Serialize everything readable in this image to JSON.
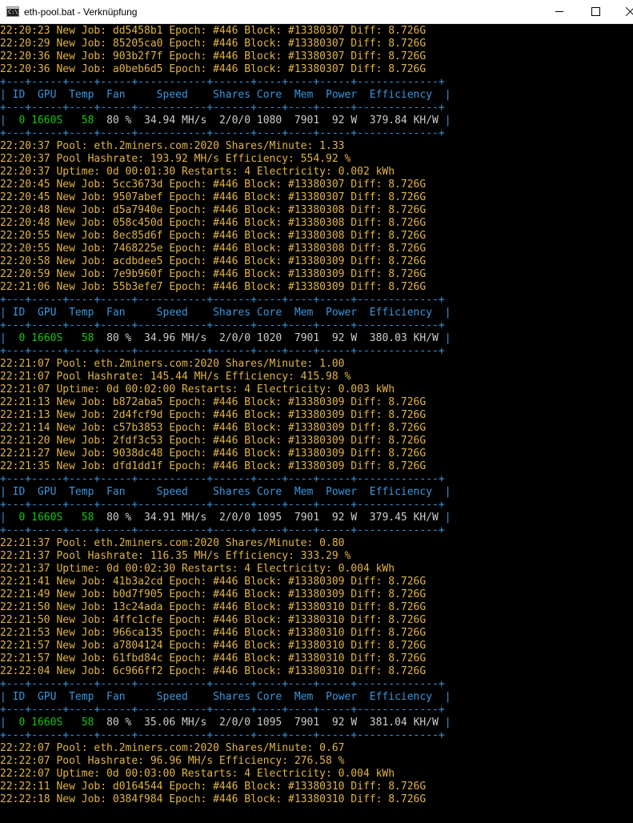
{
  "window": {
    "title": "eth-pool.bat - Verknüpfung",
    "icon": "console-icon",
    "controls": [
      "minimize",
      "maximize",
      "close"
    ]
  },
  "colors": {
    "job_text": "#e1b445",
    "table_border": "#3a96dd",
    "gpu_id": "#16c60c"
  },
  "console": {
    "lines": [
      {
        "kind": "job",
        "text": "22:20:23 New Job: dd5458b1 Epoch: #446 Block: #13380307 Diff: 8.726G"
      },
      {
        "kind": "job",
        "text": "22:20:29 New Job: 85205ca0 Epoch: #446 Block: #13380307 Diff: 8.726G"
      },
      {
        "kind": "job",
        "text": "22:20:36 New Job: 903b2f7f Epoch: #446 Block: #13380307 Diff: 8.726G"
      },
      {
        "kind": "job",
        "text": "22:20:36 New Job: a0beb6d5 Epoch: #446 Block: #13380307 Diff: 8.726G"
      },
      {
        "kind": "border",
        "text": "+---+-----+----+-----+-----------+------+----+----+-----+-------------+"
      },
      {
        "kind": "header",
        "text": "| ID  GPU  Temp  Fan     Speed    Shares Core  Mem  Power  Efficiency  |"
      },
      {
        "kind": "border",
        "text": "+---+-----+----+-----+-----------+------+----+----+-----+-------------+"
      },
      {
        "kind": "row",
        "id": " 0",
        "gpu": "1660S",
        "temp": "58",
        "rest": "  80 %  34.94 MH/s  2/0/0 1080  7901  92 W  379.84 KH/W "
      },
      {
        "kind": "border",
        "text": "+---+-----+----+-----+-----------+------+----+----+-----+-------------+"
      },
      {
        "kind": "job",
        "text": "22:20:37 Pool: eth.2miners.com:2020 Shares/Minute: 1.33"
      },
      {
        "kind": "job",
        "text": "22:20:37 Pool Hashrate: 193.92 MH/s Efficiency: 554.92 %"
      },
      {
        "kind": "job",
        "text": "22:20:37 Uptime: 0d 00:01:30 Restarts: 4 Electricity: 0.002 kWh"
      },
      {
        "kind": "job",
        "text": "22:20:45 New Job: 5cc3673d Epoch: #446 Block: #13380307 Diff: 8.726G"
      },
      {
        "kind": "job",
        "text": "22:20:45 New Job: 9507abef Epoch: #446 Block: #13380307 Diff: 8.726G"
      },
      {
        "kind": "job",
        "text": "22:20:48 New Job: d5a7940e Epoch: #446 Block: #13380308 Diff: 8.726G"
      },
      {
        "kind": "job",
        "text": "22:20:48 New Job: 058c450d Epoch: #446 Block: #13380308 Diff: 8.726G"
      },
      {
        "kind": "job",
        "text": "22:20:55 New Job: 8ec85d6f Epoch: #446 Block: #13380308 Diff: 8.726G"
      },
      {
        "kind": "job",
        "text": "22:20:55 New Job: 7468225e Epoch: #446 Block: #13380308 Diff: 8.726G"
      },
      {
        "kind": "job",
        "text": "22:20:58 New Job: acdbdee5 Epoch: #446 Block: #13380309 Diff: 8.726G"
      },
      {
        "kind": "job",
        "text": "22:20:59 New Job: 7e9b960f Epoch: #446 Block: #13380309 Diff: 8.726G"
      },
      {
        "kind": "job",
        "text": "22:21:06 New Job: 55b3efe7 Epoch: #446 Block: #13380309 Diff: 8.726G"
      },
      {
        "kind": "border",
        "text": "+---+-----+----+-----+-----------+------+----+----+-----+-------------+"
      },
      {
        "kind": "header",
        "text": "| ID  GPU  Temp  Fan     Speed    Shares Core  Mem  Power  Efficiency  |"
      },
      {
        "kind": "border",
        "text": "+---+-----+----+-----+-----------+------+----+----+-----+-------------+"
      },
      {
        "kind": "row",
        "id": " 0",
        "gpu": "1660S",
        "temp": "58",
        "rest": "  80 %  34.96 MH/s  2/0/0 1020  7901  92 W  380.03 KH/W "
      },
      {
        "kind": "border",
        "text": "+---+-----+----+-----+-----------+------+----+----+-----+-------------+"
      },
      {
        "kind": "job",
        "text": "22:21:07 Pool: eth.2miners.com:2020 Shares/Minute: 1.00"
      },
      {
        "kind": "job",
        "text": "22:21:07 Pool Hashrate: 145.44 MH/s Efficiency: 415.98 %"
      },
      {
        "kind": "job",
        "text": "22:21:07 Uptime: 0d 00:02:00 Restarts: 4 Electricity: 0.003 kWh"
      },
      {
        "kind": "job",
        "text": "22:21:13 New Job: b872aba5 Epoch: #446 Block: #13380309 Diff: 8.726G"
      },
      {
        "kind": "job",
        "text": "22:21:13 New Job: 2d4fcf9d Epoch: #446 Block: #13380309 Diff: 8.726G"
      },
      {
        "kind": "job",
        "text": "22:21:14 New Job: c57b3853 Epoch: #446 Block: #13380309 Diff: 8.726G"
      },
      {
        "kind": "job",
        "text": "22:21:20 New Job: 2fdf3c53 Epoch: #446 Block: #13380309 Diff: 8.726G"
      },
      {
        "kind": "job",
        "text": "22:21:27 New Job: 9038dc48 Epoch: #446 Block: #13380309 Diff: 8.726G"
      },
      {
        "kind": "job",
        "text": "22:21:35 New Job: dfd1dd1f Epoch: #446 Block: #13380309 Diff: 8.726G"
      },
      {
        "kind": "border",
        "text": "+---+-----+----+-----+-----------+------+----+----+-----+-------------+"
      },
      {
        "kind": "header",
        "text": "| ID  GPU  Temp  Fan     Speed    Shares Core  Mem  Power  Efficiency  |"
      },
      {
        "kind": "border",
        "text": "+---+-----+----+-----+-----------+------+----+----+-----+-------------+"
      },
      {
        "kind": "row",
        "id": " 0",
        "gpu": "1660S",
        "temp": "58",
        "rest": "  80 %  34.91 MH/s  2/0/0 1095  7901  92 W  379.45 KH/W "
      },
      {
        "kind": "border",
        "text": "+---+-----+----+-----+-----------+------+----+----+-----+-------------+"
      },
      {
        "kind": "job",
        "text": "22:21:37 Pool: eth.2miners.com:2020 Shares/Minute: 0.80"
      },
      {
        "kind": "job",
        "text": "22:21:37 Pool Hashrate: 116.35 MH/s Efficiency: 333.29 %"
      },
      {
        "kind": "job",
        "text": "22:21:37 Uptime: 0d 00:02:30 Restarts: 4 Electricity: 0.004 kWh"
      },
      {
        "kind": "job",
        "text": "22:21:41 New Job: 41b3a2cd Epoch: #446 Block: #13380309 Diff: 8.726G"
      },
      {
        "kind": "job",
        "text": "22:21:49 New Job: b0d7f905 Epoch: #446 Block: #13380309 Diff: 8.726G"
      },
      {
        "kind": "job",
        "text": "22:21:50 New Job: 13c24ada Epoch: #446 Block: #13380310 Diff: 8.726G"
      },
      {
        "kind": "job",
        "text": "22:21:50 New Job: 4ffc1cfe Epoch: #446 Block: #13380310 Diff: 8.726G"
      },
      {
        "kind": "job",
        "text": "22:21:53 New Job: 966ca135 Epoch: #446 Block: #13380310 Diff: 8.726G"
      },
      {
        "kind": "job",
        "text": "22:21:57 New Job: a7804124 Epoch: #446 Block: #13380310 Diff: 8.726G"
      },
      {
        "kind": "job",
        "text": "22:21:57 New Job: 61fbd84c Epoch: #446 Block: #13380310 Diff: 8.726G"
      },
      {
        "kind": "job",
        "text": "22:22:04 New Job: 6c966ff2 Epoch: #446 Block: #13380310 Diff: 8.726G"
      },
      {
        "kind": "border",
        "text": "+---+-----+----+-----+-----------+------+----+----+-----+-------------+"
      },
      {
        "kind": "header",
        "text": "| ID  GPU  Temp  Fan     Speed    Shares Core  Mem  Power  Efficiency  |"
      },
      {
        "kind": "border",
        "text": "+---+-----+----+-----+-----------+------+----+----+-----+-------------+"
      },
      {
        "kind": "row",
        "id": " 0",
        "gpu": "1660S",
        "temp": "58",
        "rest": "  80 %  35.06 MH/s  2/0/0 1095  7901  92 W  381.04 KH/W "
      },
      {
        "kind": "border",
        "text": "+---+-----+----+-----+-----------+------+----+----+-----+-------------+"
      },
      {
        "kind": "job",
        "text": "22:22:07 Pool: eth.2miners.com:2020 Shares/Minute: 0.67"
      },
      {
        "kind": "job",
        "text": "22:22:07 Pool Hashrate: 96.96 MH/s Efficiency: 276.58 %"
      },
      {
        "kind": "job",
        "text": "22:22:07 Uptime: 0d 00:03:00 Restarts: 4 Electricity: 0.004 kWh"
      },
      {
        "kind": "job",
        "text": "22:22:11 New Job: d0164544 Epoch: #446 Block: #13380310 Diff: 8.726G"
      },
      {
        "kind": "job",
        "text": "22:22:18 New Job: 0384f984 Epoch: #446 Block: #13380310 Diff: 8.726G"
      }
    ]
  }
}
